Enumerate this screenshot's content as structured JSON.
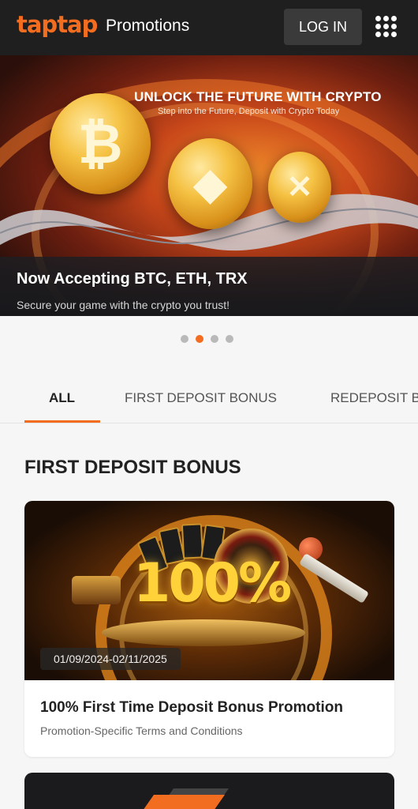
{
  "header": {
    "logo_text": "taptap",
    "title": "Promotions",
    "login_label": "LOG IN",
    "menu_icon": "grid-menu-icon"
  },
  "hero": {
    "headline": "UNLOCK THE FUTURE WITH CRYPTO",
    "subheadline": "Step into the Future, Deposit with Crypto Today",
    "title": "Now Accepting BTC, ETH, TRX",
    "text": "Secure your game with the crypto you trust!",
    "coins": [
      "bitcoin-coin-icon",
      "ethereum-coin-icon",
      "xrp-coin-icon"
    ]
  },
  "carousel": {
    "total": 4,
    "active_index": 1
  },
  "tabs": [
    {
      "label": "ALL",
      "active": true
    },
    {
      "label": "FIRST DEPOSIT BONUS",
      "active": false
    },
    {
      "label": "REDEPOSIT B",
      "active": false
    }
  ],
  "section": {
    "title": "FIRST DEPOSIT BONUS"
  },
  "promo_card": {
    "banner_text": "100%",
    "date_range": "01/09/2024-02/11/2025",
    "title": "100% First Time Deposit Bonus Promotion",
    "subtitle": "Promotion-Specific Terms and Conditions"
  },
  "colors": {
    "accent": "#f26d1f",
    "header_bg": "#1f1f1f",
    "page_bg": "#f6f6f6"
  }
}
